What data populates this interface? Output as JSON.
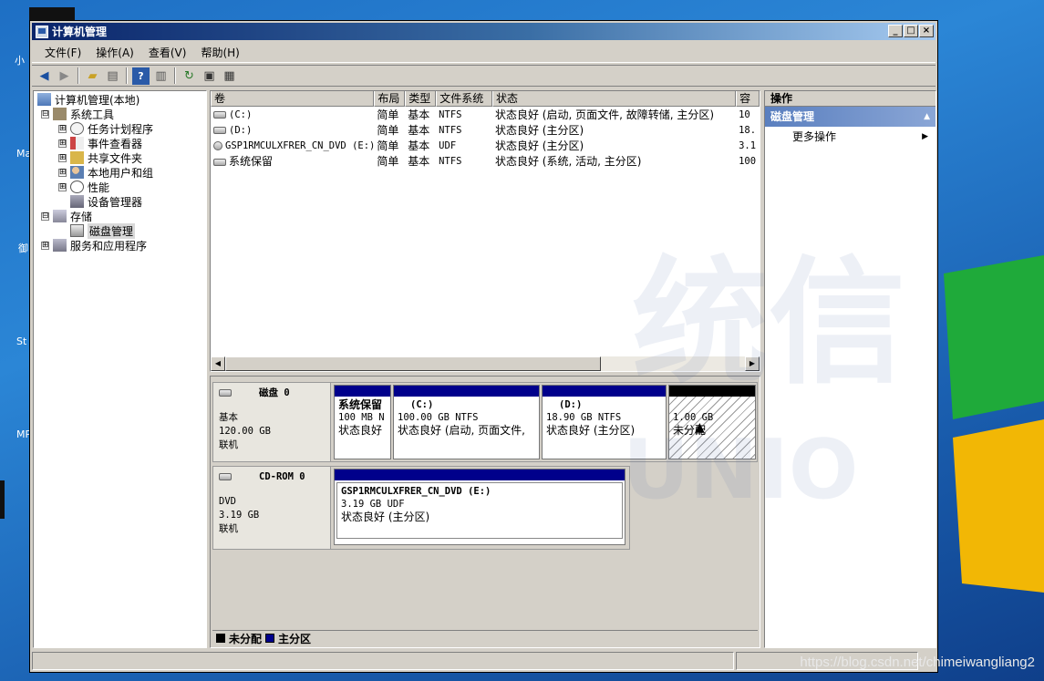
{
  "window": {
    "title": "计算机管理",
    "controls": {
      "minimize": "_",
      "maximize": "□",
      "close": "×"
    }
  },
  "menu": [
    "文件(F)",
    "操作(A)",
    "查看(V)",
    "帮助(H)"
  ],
  "toolbar": {
    "icons": [
      "back-icon",
      "forward-icon",
      "up-folder-icon",
      "show-hide-tree-icon",
      "help-icon",
      "show-action-pane-icon",
      "refresh-icon",
      "export-list-icon",
      "properties-icon"
    ]
  },
  "tree": {
    "root": "计算机管理(本地)",
    "items": [
      {
        "label": "系统工具",
        "expander": "⊟"
      },
      {
        "label": "任务计划程序",
        "expander": "⊞"
      },
      {
        "label": "事件查看器",
        "expander": "⊞"
      },
      {
        "label": "共享文件夹",
        "expander": "⊞"
      },
      {
        "label": "本地用户和组",
        "expander": "⊞"
      },
      {
        "label": "性能",
        "expander": "⊞"
      },
      {
        "label": "设备管理器",
        "expander": ""
      },
      {
        "label": "存储",
        "expander": "⊟"
      },
      {
        "label": "磁盘管理",
        "expander": ""
      },
      {
        "label": "服务和应用程序",
        "expander": "⊞"
      }
    ]
  },
  "volumes": {
    "headers": [
      "卷",
      "布局",
      "类型",
      "文件系统",
      "状态",
      "容"
    ],
    "rows": [
      {
        "volume": "(C:)",
        "layout": "简单",
        "type": "基本",
        "fs": "NTFS",
        "status": "状态良好 (启动, 页面文件, 故障转储, 主分区)",
        "cap": "10"
      },
      {
        "volume": "(D:)",
        "layout": "简单",
        "type": "基本",
        "fs": "NTFS",
        "status": "状态良好 (主分区)",
        "cap": "18."
      },
      {
        "volume": "GSP1RMCULXFRER_CN_DVD (E:)",
        "layout": "简单",
        "type": "基本",
        "fs": "UDF",
        "status": "状态良好 (主分区)",
        "cap": "3.1"
      },
      {
        "volume": "系统保留",
        "layout": "简单",
        "type": "基本",
        "fs": "NTFS",
        "status": "状态良好 (系统, 活动, 主分区)",
        "cap": "100"
      }
    ]
  },
  "disks": [
    {
      "name": "磁盘 0",
      "kind": "基本",
      "size": "120.00 GB",
      "state": "联机",
      "partitions": [
        {
          "title": "系统保留",
          "line2": "100 MB N",
          "line3": "状态良好"
        },
        {
          "title": "(C:)",
          "line2": "100.00 GB NTFS",
          "line3": "状态良好 (启动, 页面文件,"
        },
        {
          "title": "(D:)",
          "line2": "18.90 GB NTFS",
          "line3": "状态良好 (主分区)"
        },
        {
          "title": "",
          "line2": "1.00 GB",
          "line3": "未分配"
        }
      ]
    },
    {
      "name": "CD-ROM 0",
      "kind": "DVD",
      "size": "3.19 GB",
      "state": "联机",
      "partitions": [
        {
          "title": "GSP1RMCULXFRER_CN_DVD  (E:)",
          "line2": "3.19 GB UDF",
          "line3": "状态良好 (主分区)"
        }
      ]
    }
  ],
  "legend": [
    {
      "label": "未分配",
      "color": "#000000"
    },
    {
      "label": "主分区",
      "color": "#00008b"
    }
  ],
  "actions": {
    "title": "操作",
    "section": "磁盘管理",
    "items": [
      "更多操作"
    ]
  },
  "watermark": "https://blog.csdn.net/chimeiwangliang2",
  "colors": {
    "title_gradient_start": "#0a246a",
    "primary_partition": "#00008b",
    "unallocated": "#000000",
    "desktop": "#1e6fc4"
  }
}
